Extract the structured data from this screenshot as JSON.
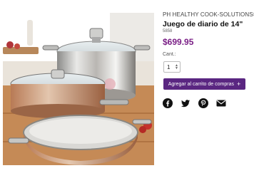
{
  "product": {
    "brand": "PH HEALTHY COOK-SOLUTIONS®",
    "title": "Juego de diario de 14\"",
    "sku": "5858",
    "price": "$699.95"
  },
  "quantity": {
    "label": "Cant.:",
    "value": "1"
  },
  "cart": {
    "button_label": "Agregar al carrito de compras",
    "plus": "+"
  },
  "share": {
    "icons": [
      "facebook-icon",
      "twitter-icon",
      "pinterest-icon",
      "email-icon"
    ]
  },
  "colors": {
    "brand_purple": "#5a2681",
    "price": "#7a1f86"
  }
}
